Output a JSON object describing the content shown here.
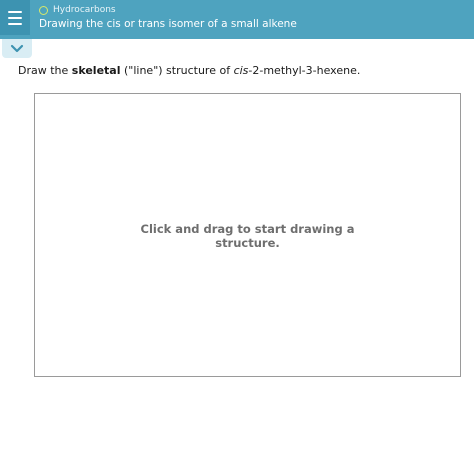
{
  "header": {
    "topic": "Hydrocarbons",
    "title": "Drawing the cis or trans isomer of a small alkene"
  },
  "question": {
    "prefix": "Draw the ",
    "bold_term": "skeletal",
    "middle": " (\"line\") structure of ",
    "italic_prefix": "cis",
    "compound_rest": "-2-methyl-3-hexene."
  },
  "canvas": {
    "hint": "Click and drag to start drawing a structure."
  },
  "colors": {
    "header_bg": "#4ea3bf",
    "menu_bg": "#3d93b1",
    "topic_dot": "#d6e86a",
    "collapse_tab_bg": "#d9edf4",
    "chevron": "#3d93b1"
  },
  "icons": {
    "menu": "hamburger-menu-icon",
    "topic": "topic-circle-icon",
    "collapse": "chevron-down-icon"
  }
}
